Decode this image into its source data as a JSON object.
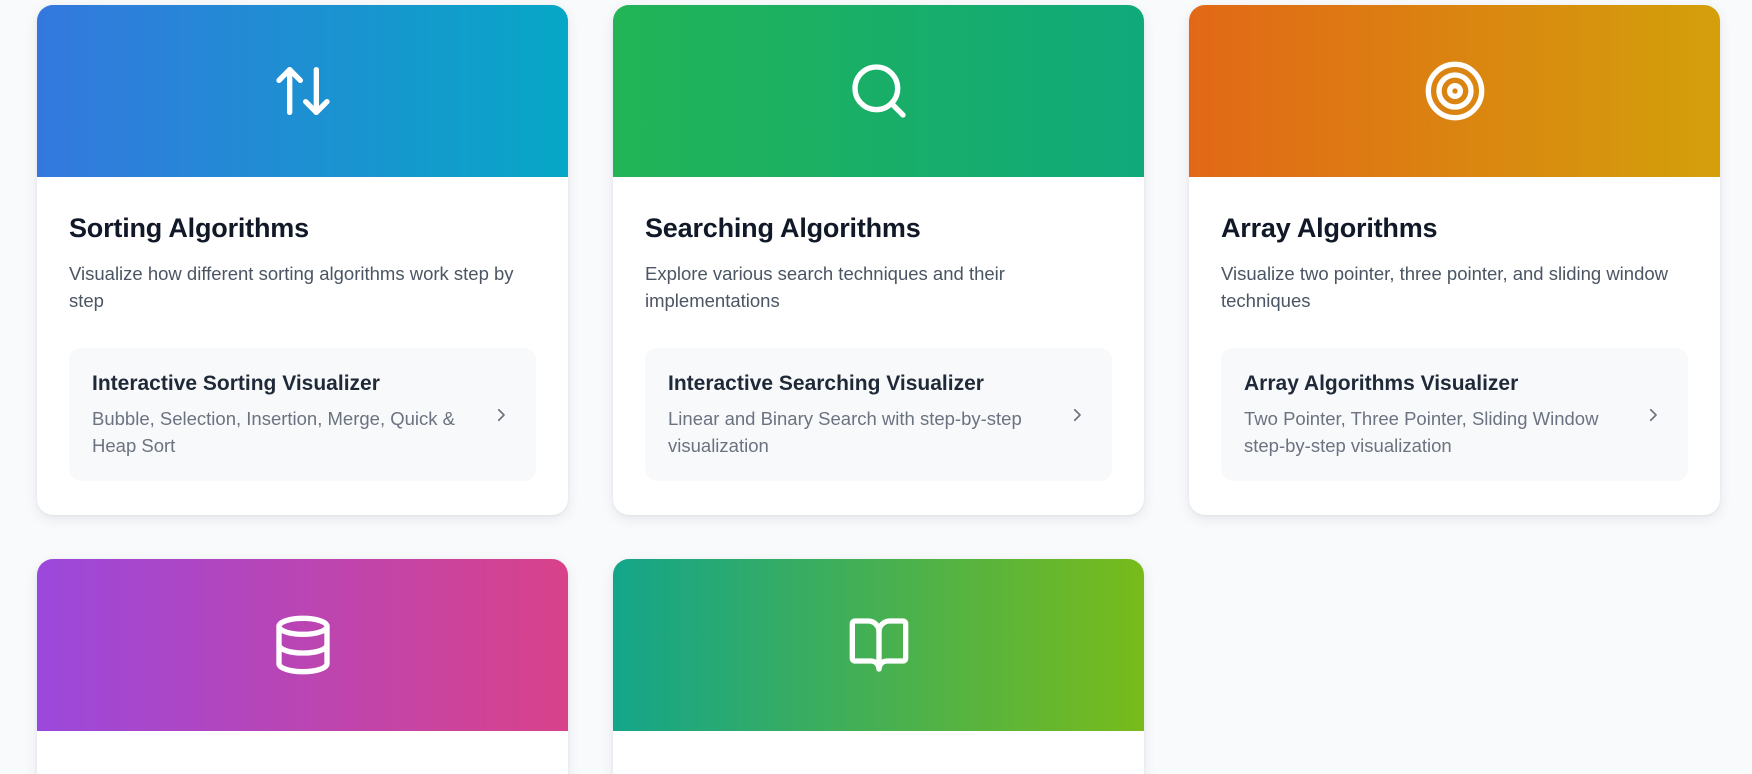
{
  "cards": [
    {
      "icon": "arrows-up-down-icon",
      "title": "Sorting Algorithms",
      "description": "Visualize how different sorting algorithms work step by step",
      "link": {
        "title": "Interactive Sorting Visualizer",
        "description": "Bubble, Selection, Insertion, Merge, Quick & Heap Sort"
      },
      "gradient": [
        "#3478de",
        "#07a7c6"
      ]
    },
    {
      "icon": "search-icon",
      "title": "Searching Algorithms",
      "description": "Explore various search techniques and their implementations",
      "link": {
        "title": "Interactive Searching Visualizer",
        "description": "Linear and Binary Search with step-by-step visualization"
      },
      "gradient": [
        "#22b456",
        "#10a97a"
      ]
    },
    {
      "icon": "target-icon",
      "title": "Array Algorithms",
      "description": "Visualize two pointer, three pointer, and sliding window techniques",
      "link": {
        "title": "Array Algorithms Visualizer",
        "description": "Two Pointer, Three Pointer, Sliding Window step-by-step visualization"
      },
      "gradient": [
        "#e26817",
        "#d3a00b"
      ]
    },
    {
      "icon": "database-icon",
      "gradient": [
        "#9b48dc",
        "#d9428a"
      ]
    },
    {
      "icon": "book-open-icon",
      "gradient": [
        "#14a58a",
        "#78bb1a"
      ]
    }
  ]
}
